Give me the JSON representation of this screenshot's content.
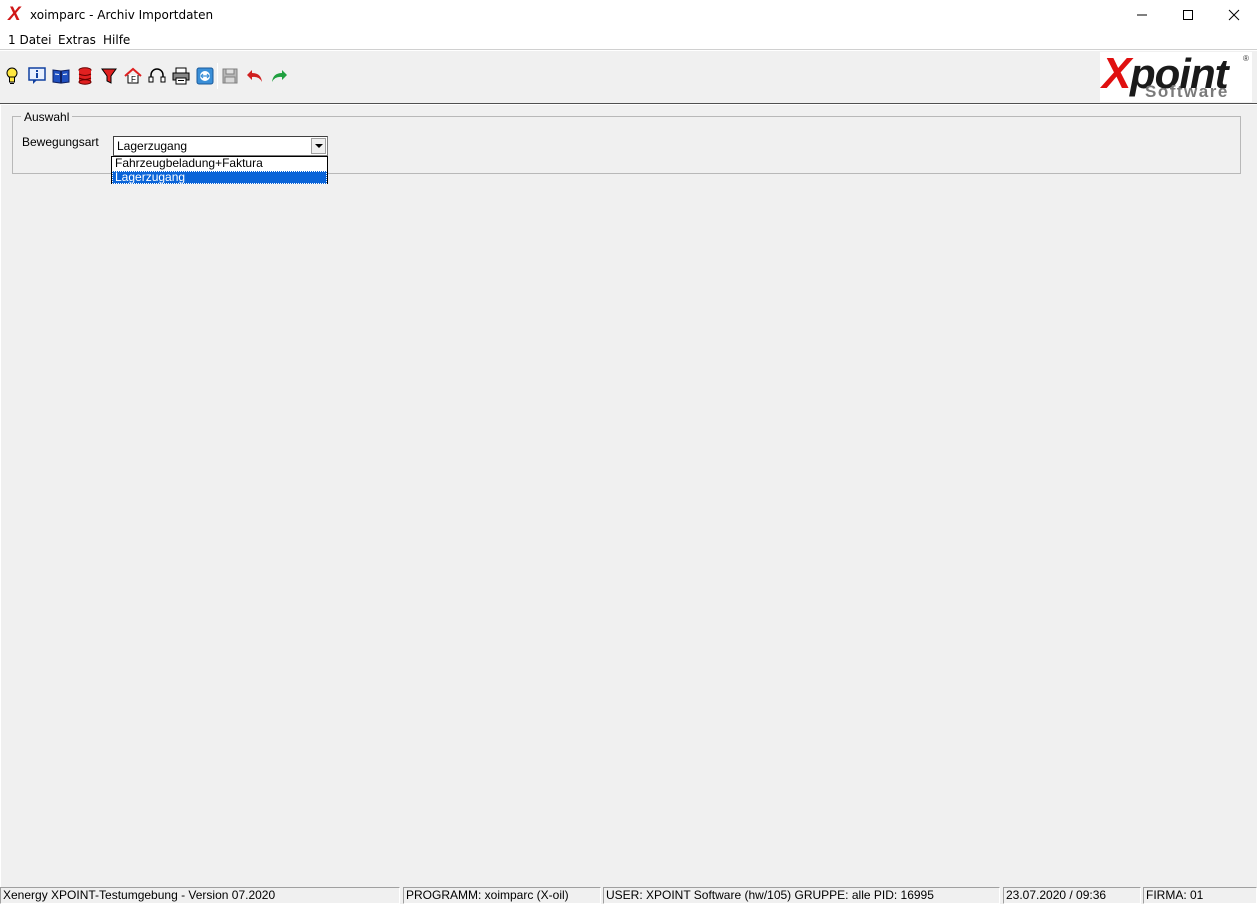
{
  "window": {
    "title": "xoimparc - Archiv Importdaten",
    "app_icon_glyph": "X"
  },
  "menu": {
    "items": [
      "1 Datei",
      "Extras",
      "Hilfe"
    ]
  },
  "toolbar": {
    "buttons": [
      {
        "icon": "lightbulb-icon"
      },
      {
        "icon": "info-icon"
      },
      {
        "icon": "book-icon"
      },
      {
        "icon": "database-icon"
      },
      {
        "icon": "filter-icon"
      },
      {
        "icon": "home-icon"
      },
      {
        "icon": "headset-icon"
      },
      {
        "icon": "printer-icon"
      },
      {
        "icon": "remote-icon"
      },
      {
        "icon": "save-icon"
      },
      {
        "icon": "undo-icon"
      },
      {
        "icon": "redo-icon"
      }
    ],
    "logo": {
      "brand_x": "X",
      "brand_rest": "point",
      "brand_sub": "Software",
      "registered": "®"
    }
  },
  "selection": {
    "group_title": "Auswahl",
    "field_label": "Bewegungsart",
    "current_value": "Lagerzugang",
    "options": [
      "Fahrzeugbeladung+Faktura",
      "Lagerzugang"
    ],
    "selected_index": 1
  },
  "status": {
    "environment": "Xenergy XPOINT-Testumgebung - Version 07.2020",
    "program": "PROGRAMM: xoimparc (X-oil)",
    "user": "USER: XPOINT Software (hw/105)  GRUPPE: alle  PID: 16995",
    "datetime": "23.07.2020 / 09:36",
    "firma": "FIRMA: 01"
  },
  "colors": {
    "brand_red": "#e01010",
    "selection_blue": "#0a64d8",
    "undo_red": "#d02020",
    "redo_green": "#20a040"
  }
}
